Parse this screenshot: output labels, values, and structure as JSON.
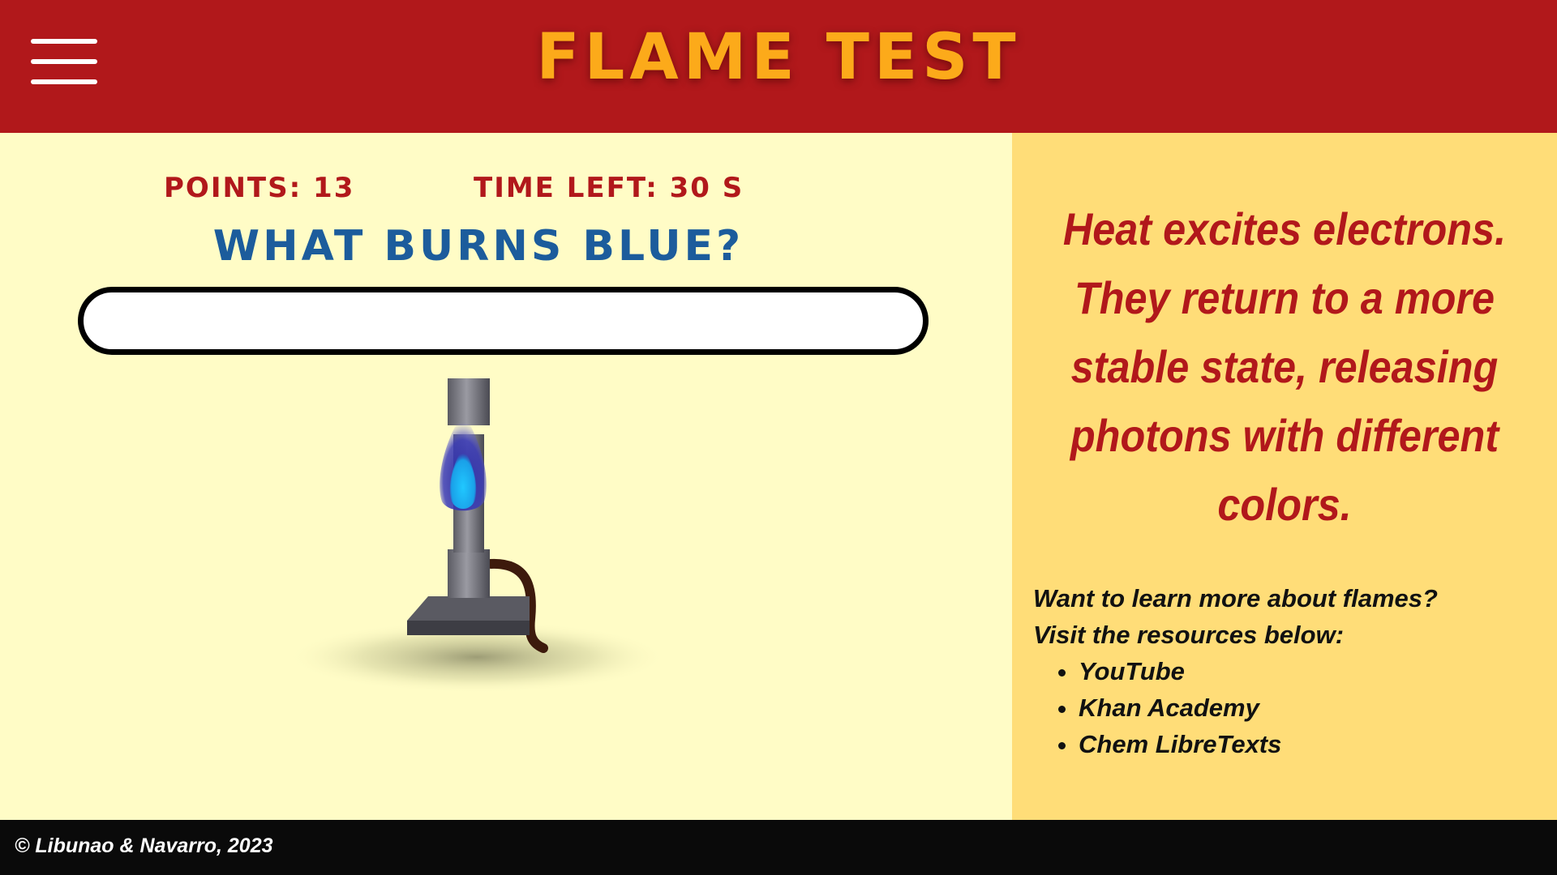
{
  "header": {
    "title": "FLAME TEST",
    "menu_icon": "hamburger-menu-icon"
  },
  "game": {
    "points_label": "POINTS: 13",
    "time_label": "TIME LEFT: 30 S",
    "question": "WHAT BURNS BLUE?",
    "answer_value": "",
    "answer_placeholder": "",
    "illustration_icon": "bunsen-burner-icon",
    "flame_color": "#1aa0e8"
  },
  "info": {
    "explanation": "Heat excites electrons. They return to a more stable state, releasing photons with different colors.",
    "learn_more_line1": "Want to learn more about flames?",
    "learn_more_line2": "Visit the resources below:",
    "resources": [
      "YouTube",
      "Khan Academy",
      "Chem LibreTexts"
    ]
  },
  "footer": {
    "copyright": "© Libunao & Navarro, 2023"
  },
  "colors": {
    "header_bg": "#b1181b",
    "title": "#fcaa1a",
    "left_bg": "#fffcc6",
    "right_bg": "#ffdd78",
    "question": "#1c5c9c",
    "accent_red": "#b1181b",
    "footer_bg": "#0a0a0a"
  }
}
